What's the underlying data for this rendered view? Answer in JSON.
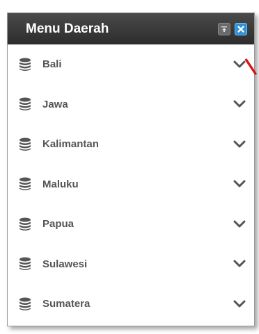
{
  "panel": {
    "title": "Menu Daerah",
    "collapse_icon": "collapse-up-icon",
    "close_icon": "close-icon"
  },
  "menu": {
    "items": [
      {
        "label": "Bali",
        "icon": "database-icon"
      },
      {
        "label": "Jawa",
        "icon": "database-icon"
      },
      {
        "label": "Kalimantan",
        "icon": "database-icon"
      },
      {
        "label": "Maluku",
        "icon": "database-icon"
      },
      {
        "label": "Papua",
        "icon": "database-icon"
      },
      {
        "label": "Sulawesi",
        "icon": "database-icon"
      },
      {
        "label": "Sumatera",
        "icon": "database-icon"
      }
    ]
  },
  "colors": {
    "header": "#333333",
    "close_button": "#2f8fd6",
    "text": "#555555",
    "annotation_arrow": "#e01010"
  }
}
